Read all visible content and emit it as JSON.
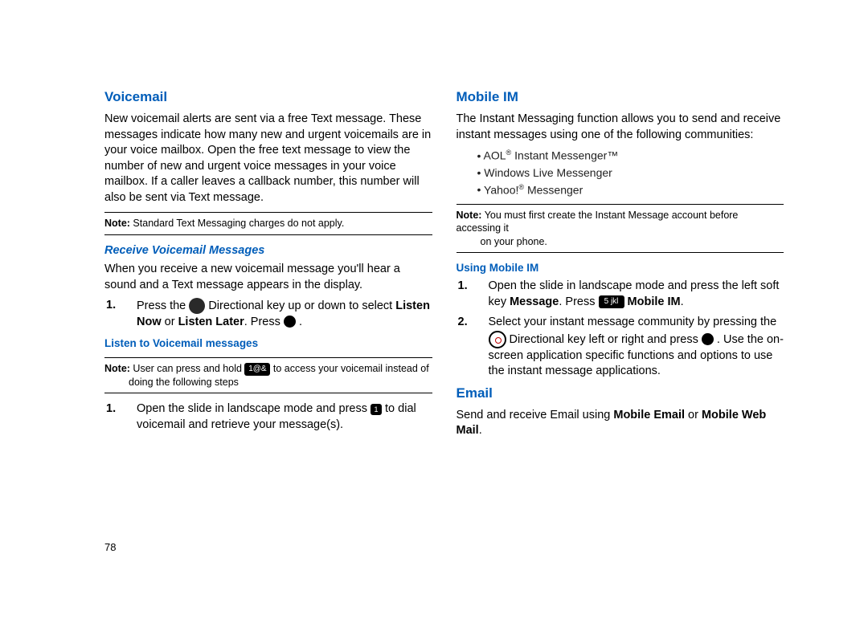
{
  "pageNumber": "78",
  "left": {
    "h1": "Voicemail",
    "intro": "New voicemail alerts are sent via a free Text message. These messages indicate how many new and urgent voicemails are in your voice mailbox. Open the free text message to view the number of new and urgent voice messages in your voice mailbox. If a caller leaves a callback number, this number will also be sent via Text message.",
    "note1_label": "Note:",
    "note1_text": " Standard Text Messaging charges do not apply.",
    "h2": "Receive Voicemail Messages",
    "receive_intro": "When you receive a new voicemail message you'll hear a sound and a Text message appears in the display.",
    "step1_num": "1.",
    "step1_a": "Press the ",
    "step1_b": " Directional key up or down to select ",
    "step1_bold": "Listen Now",
    "step1_or": " or ",
    "step1_bold2": "Listen Later",
    "step1_c": ". Press ",
    "step1_d": " .",
    "h3": "Listen to Voicemail messages",
    "note2_label": "Note:",
    "note2_a": " User can press and hold ",
    "note2_b": " to access your voicemail instead of doing the following steps",
    "stepL1_num": "1.",
    "stepL1_a": "Open the slide in landscape mode and press ",
    "stepL1_b": " to dial voicemail and retrieve your message(s)."
  },
  "right": {
    "h1": "Mobile IM",
    "intro": "The Instant Messaging function allows you to send and receive instant messages using one of the following communities:",
    "bullets": {
      "b1a": "AOL",
      "b1b": " Instant Messenger™",
      "b2": "Windows Live Messenger",
      "b3a": "Yahoo!",
      "b3b": " Messenger"
    },
    "note_label": "Note:",
    "note_text": " You must first create the Instant Message account before accessing it on your phone.",
    "h2": "Using Mobile IM",
    "s1_num": "1.",
    "s1_a": "Open the slide in landscape mode and press the left soft key ",
    "s1_bold1": "Message",
    "s1_b": ". Press ",
    "s1_bold2": " Mobile IM",
    "s1_c": ".",
    "s2_num": "2.",
    "s2_a": "Select your instant message community by pressing the ",
    "s2_b": " Directional key left or right and press ",
    "s2_c": " . Use the on-screen application specific functions and options to use the instant message applications.",
    "h3": "Email",
    "email_a": "Send and receive Email using ",
    "email_bold1": "Mobile Email",
    "email_or": " or ",
    "email_bold2": "Mobile Web Mail",
    "email_c": "."
  },
  "keys": {
    "voicemail_hold": "1@&",
    "voicemail_dial": "1",
    "jkl": "5 jkl"
  }
}
